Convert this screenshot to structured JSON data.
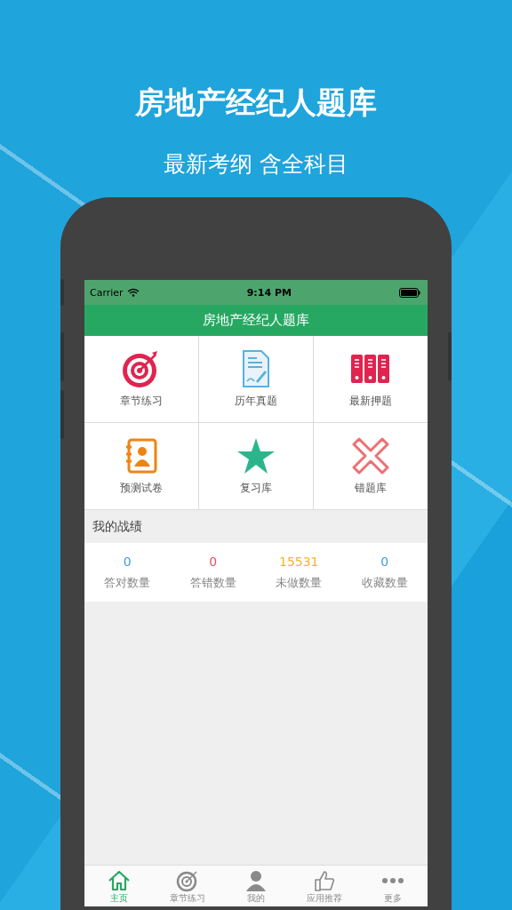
{
  "promo": {
    "headline": "房地产经纪人题库",
    "subtitle": "最新考纲 含全科目"
  },
  "status_bar": {
    "carrier": "Carrier",
    "time": "9:14 PM"
  },
  "nav_bar": {
    "title": "房地产经纪人题库"
  },
  "menu": [
    {
      "label": "章节练习",
      "kind": "target"
    },
    {
      "label": "历年真题",
      "kind": "document"
    },
    {
      "label": "最新押题",
      "kind": "binders"
    },
    {
      "label": "预测试卷",
      "kind": "contacts"
    },
    {
      "label": "复习库",
      "kind": "star"
    },
    {
      "label": "错题库",
      "kind": "cross"
    }
  ],
  "stats": {
    "title": "我的战绩",
    "items": [
      {
        "value": "0",
        "label": "答对数量",
        "color": "#3a9ee0"
      },
      {
        "value": "0",
        "label": "答错数量",
        "color": "#e8505b"
      },
      {
        "value": "15531",
        "label": "未做数量",
        "color": "#f5b623"
      },
      {
        "value": "0",
        "label": "收藏数量",
        "color": "#3a9ee0"
      }
    ]
  },
  "tab_bar": [
    {
      "label": "主页",
      "kind": "home",
      "selected": true
    },
    {
      "label": "章节练习",
      "kind": "target",
      "selected": false
    },
    {
      "label": "我的",
      "kind": "person",
      "selected": false
    },
    {
      "label": "应用推荐",
      "kind": "thumb",
      "selected": false
    },
    {
      "label": "更多",
      "kind": "more",
      "selected": false
    }
  ]
}
